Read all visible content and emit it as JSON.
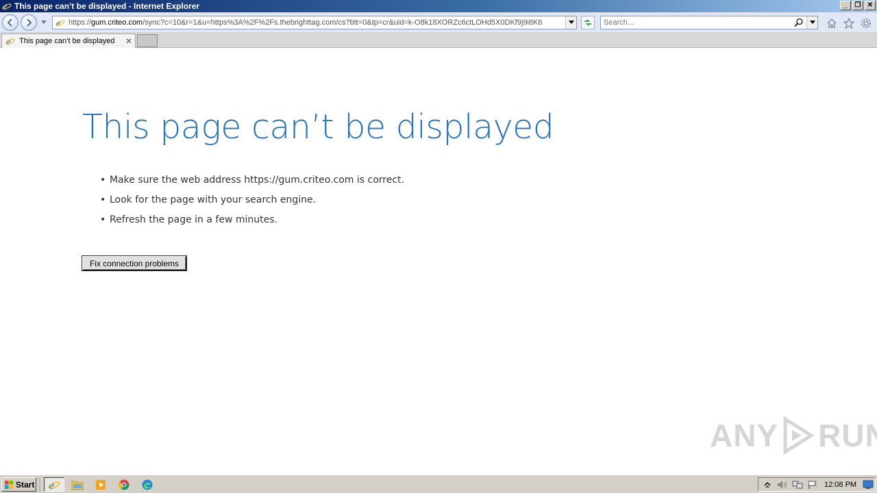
{
  "window": {
    "title": "This page can’t be displayed - Internet Explorer",
    "minimize": "_",
    "restore": "❐",
    "close": "✕"
  },
  "navbar": {
    "url_prefix": "https://",
    "url_domain": "gum.criteo.com",
    "url_rest": "/sync?c=10&r=1&u=https%3A%2F%2Fs.thebrighttag.com/cs?btt=0&tp=cr&uid=k-O8k18XORZc6ctLOHd5X0DKf9j9i8K6",
    "search_placeholder": "Search..."
  },
  "tabs": [
    {
      "label": "This page can’t be displayed",
      "close": "✕"
    }
  ],
  "content": {
    "heading": "This page can’t be displayed",
    "bullet": "•",
    "tips": [
      "Make sure the web address https://gum.criteo.com is correct.",
      "Look for the page with your search engine.",
      "Refresh the page in a few minutes."
    ],
    "fix_button": "Fix connection problems"
  },
  "watermark": {
    "left": "ANY",
    "right": "RUN"
  },
  "taskbar": {
    "start_label": "Start",
    "clock": "12:08 PM",
    "apps": [
      "internet-explorer",
      "file-explorer",
      "media-player",
      "chrome",
      "edge"
    ]
  },
  "colors": {
    "heading": "#2672c4",
    "titlebar_start": "#0a246a",
    "titlebar_end": "#a6caf0"
  }
}
